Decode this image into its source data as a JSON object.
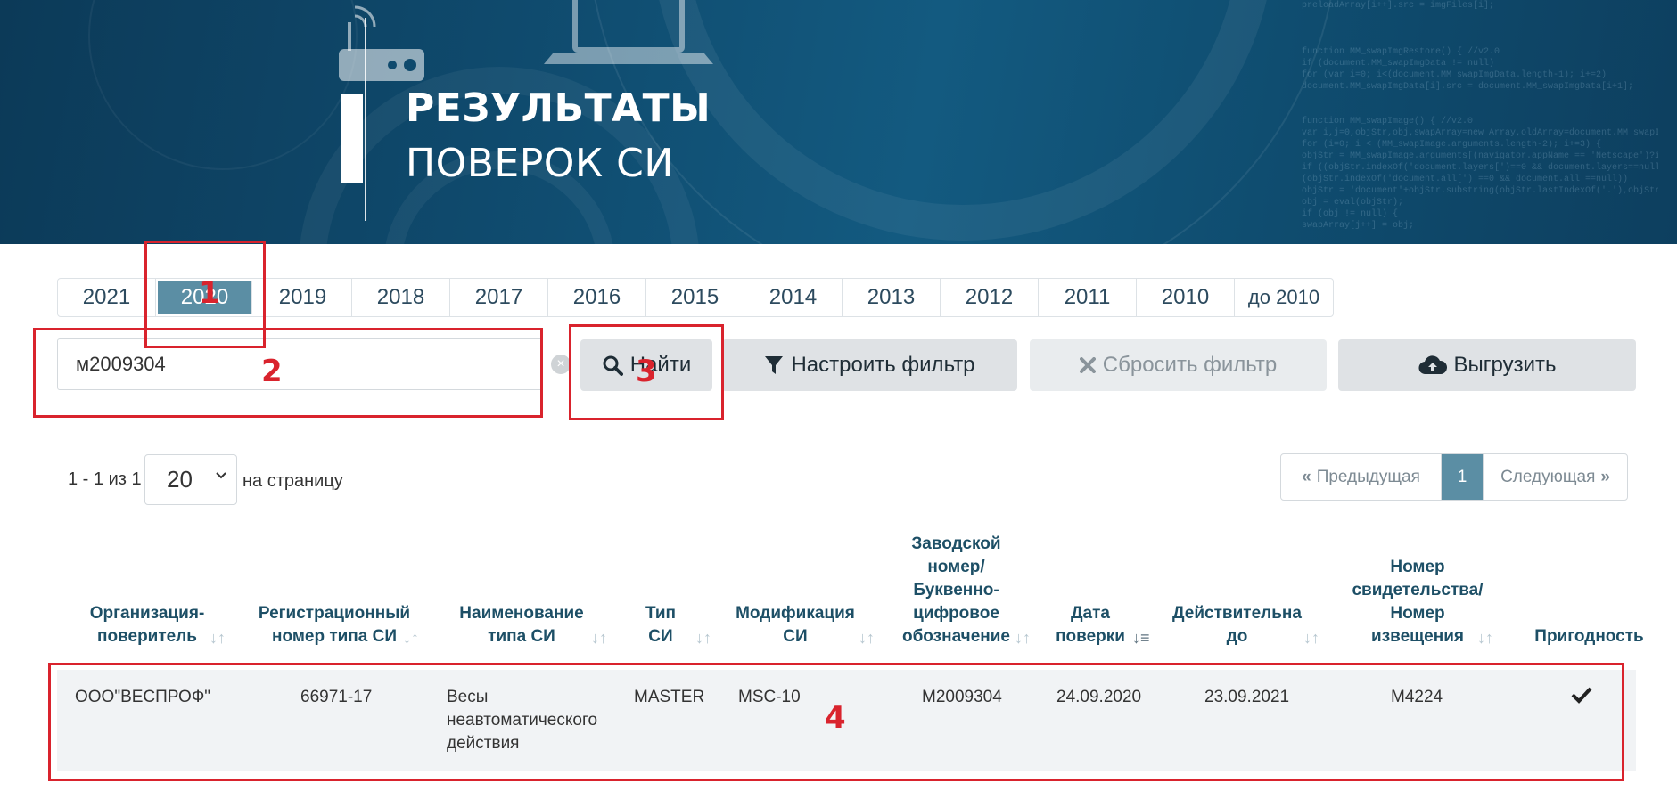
{
  "banner": {
    "title_line1": "РЕЗУЛЬТАТЫ",
    "title_line2": "ПОВЕРОК СИ",
    "code_text": "preloadArray[i++].src = imgFiles[i];\n\n\n\nfunction MM_swapImgRestore() { //v2.0\nif (document.MM_swapImgData != null)\nfor (var i=0; i<(document.MM_swapImgData.length-1); i+=2)\ndocument.MM_swapImgData[i].src = document.MM_swapImgData[i+1];\n\n\nfunction MM_swapImage() { //v2.0\nvar i,j=0,objStr,obj,swapArray=new Array,oldArray=document.MM_swapI\nfor (i=0; i < (MM_swapImage.arguments.length-2); i+=3) {\nobjStr = MM_swapImage.arguments[(navigator.appName == 'Netscape')?i:i\nif ((objStr.indexOf('document.layers[')==0 && document.layers==null) ||\n(objStr.indexOf('document.all[') ==0 && document.all ==null))\nobjStr = 'document'+objStr.substring(objStr.lastIndexOf('.'),objStr.length);\nobj = eval(objStr);\nif (obj != null) {\nswapArray[j++] = obj;"
  },
  "years": {
    "items": [
      "2021",
      "2020",
      "2019",
      "2018",
      "2017",
      "2016",
      "2015",
      "2014",
      "2013",
      "2012",
      "2011",
      "2010",
      "до 2010"
    ],
    "active": "2020"
  },
  "search": {
    "value": "м2009304",
    "clear_icon": "×"
  },
  "buttons": {
    "find": "Найти",
    "filter": "Настроить фильтр",
    "reset": "Сбросить фильтр",
    "export": "Выгрузить"
  },
  "annotations": [
    "1",
    "2",
    "3",
    "4"
  ],
  "pagination": {
    "range": "1 - 1 из 1",
    "per_page": "20",
    "per_page_label": "на страницу",
    "prev": "Предыдущая",
    "current": "1",
    "next": "Следующая"
  },
  "table": {
    "headers": [
      [
        "Организация-",
        "поверитель"
      ],
      [
        "Регистрационный",
        "номер типа СИ"
      ],
      [
        "Наименование",
        "типа СИ"
      ],
      [
        "Тип",
        "СИ"
      ],
      [
        "Модификация",
        "СИ"
      ],
      [
        "Заводской",
        "номер/",
        "Буквенно-",
        "цифровое",
        "обозначение"
      ],
      [
        "Дата",
        "поверки"
      ],
      [
        "Действительна",
        "до"
      ],
      [
        "Номер",
        "свидетельства/",
        "Номер",
        "извещения"
      ],
      [
        "Пригодность"
      ]
    ],
    "rows": [
      {
        "org": "ООО\"ВЕСПРОФ\"",
        "reg_num": "66971-17",
        "name": [
          "Весы",
          "неавтоматического",
          "действия"
        ],
        "type": "MASTER",
        "modification": "MSC-10",
        "serial": "M2009304",
        "date": "24.09.2020",
        "valid_until": "23.09.2021",
        "cert_num": "M4224",
        "fitness_icon": "check-icon"
      }
    ]
  },
  "colors": {
    "accent": "#5b8ea4",
    "annotation": "#d9232d",
    "header_text": "#1d4f66"
  }
}
